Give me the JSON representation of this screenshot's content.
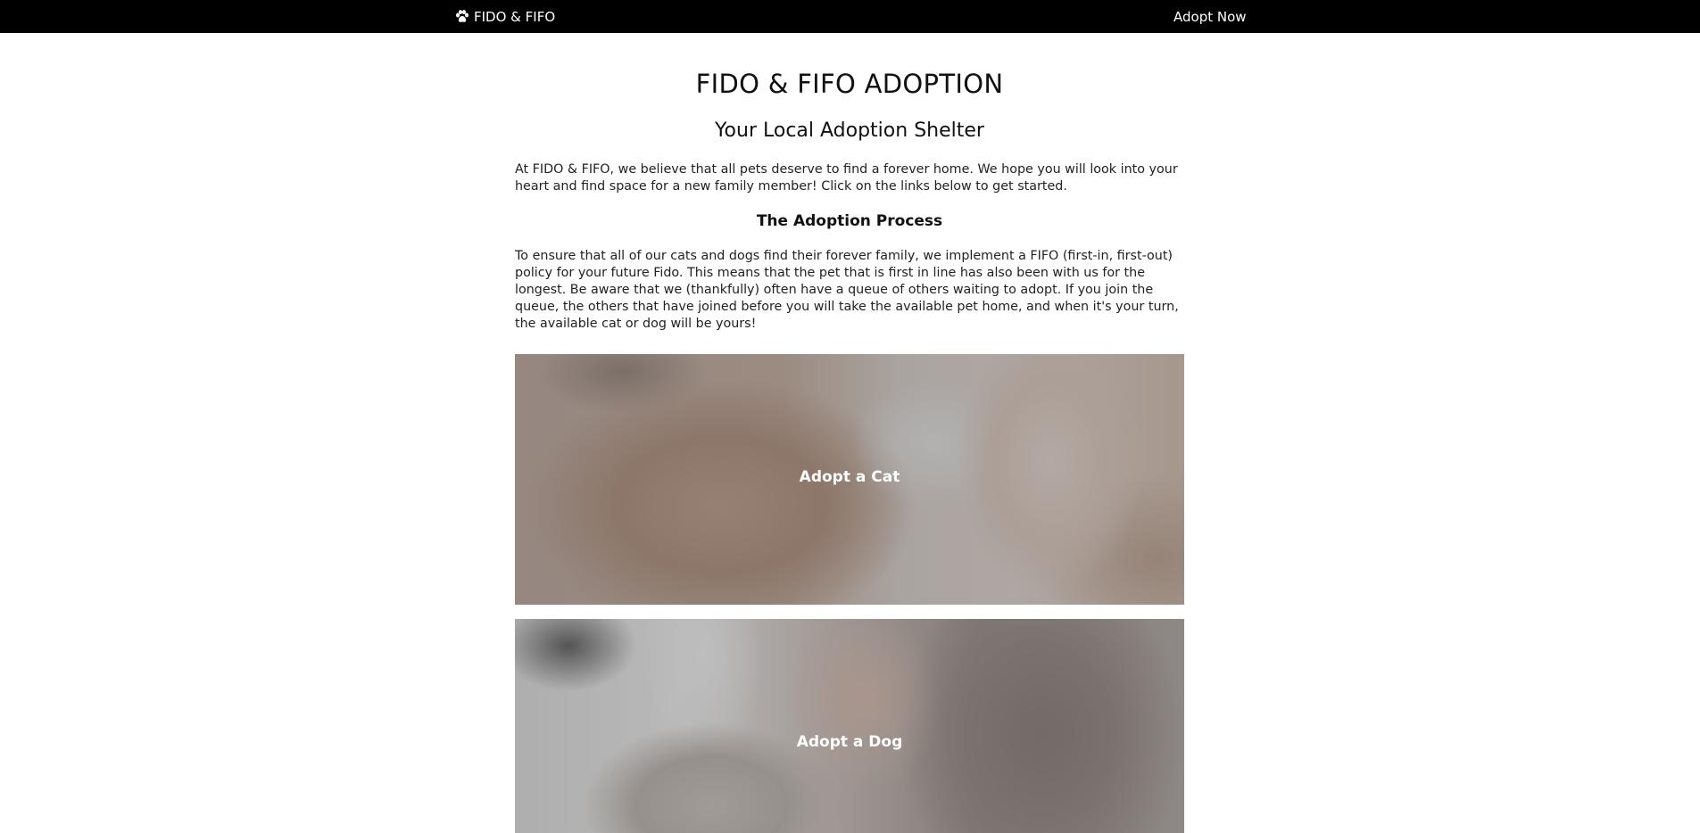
{
  "navbar": {
    "brand_icon": "paw-icon",
    "brand_label": "FIDO & FIFO",
    "adopt_now_label": "Adopt Now"
  },
  "main": {
    "title": "FIDO & FIFO ADOPTION",
    "subtitle": "Your Local Adoption Shelter",
    "intro": "At FIDO & FIFO, we believe that all pets deserve to find a forever home. We hope you will look into your heart and find space for a new family member! Click on the links below to get started.",
    "process_heading": "The Adoption Process",
    "process_text": "To ensure that all of our cats and dogs find their forever family, we implement a FIFO (first-in, first-out) policy for your future Fido. This means that the pet that is first in line has also been with us for the longest. Be aware that we (thankfully) often have a queue of others waiting to adopt. If you join the queue, the others that have joined before you will take the available pet home, and when it's your turn, the available cat or dog will be yours!"
  },
  "cards": {
    "cat_label": "Adopt a Cat",
    "dog_label": "Adopt a Dog"
  },
  "colors": {
    "navbar_bg": "#000000",
    "navbar_text": "#ffffff",
    "page_bg": "#ffffff",
    "overlay": "#787878"
  }
}
